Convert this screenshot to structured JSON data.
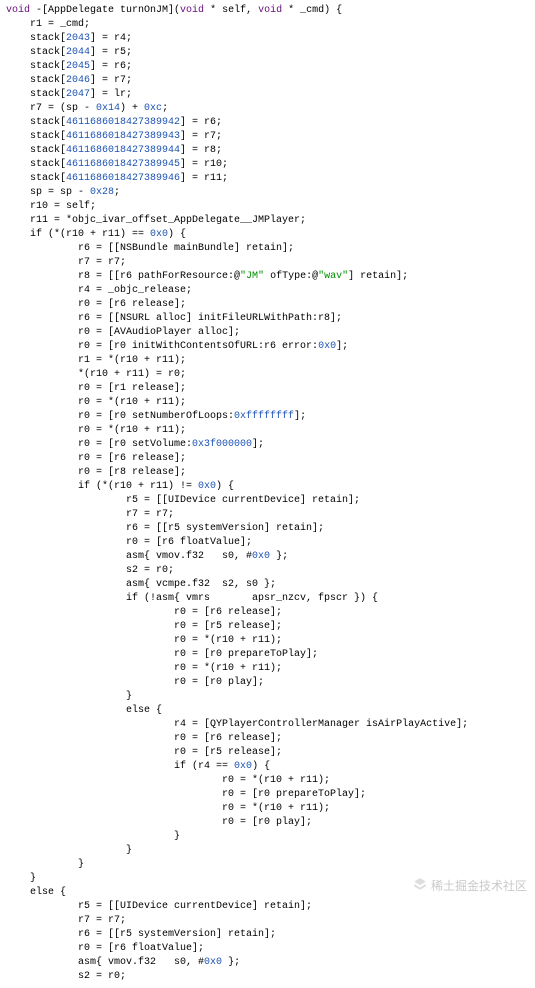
{
  "code": {
    "sig_kw": "void",
    "sig_rest": " -[AppDelegate turnOnJM](",
    "sig_kw2": "void",
    "sig_mid": " * self, ",
    "sig_kw3": "void",
    "sig_end": " * _cmd) {",
    "l01": "    r1 = _cmd;",
    "l02a": "    stack[",
    "l02n": "2043",
    "l02b": "] = r4;",
    "l03a": "    stack[",
    "l03n": "2044",
    "l03b": "] = r5;",
    "l04a": "    stack[",
    "l04n": "2045",
    "l04b": "] = r6;",
    "l05a": "    stack[",
    "l05n": "2046",
    "l05b": "] = r7;",
    "l06a": "    stack[",
    "l06n": "2047",
    "l06b": "] = lr;",
    "l07a": "    r7 = (sp - ",
    "l07n1": "0x14",
    "l07m": ") + ",
    "l07n2": "0xc",
    "l07e": ";",
    "l08a": "    stack[",
    "l08n": "4611686018427389942",
    "l08b": "] = r6;",
    "l09a": "    stack[",
    "l09n": "4611686018427389943",
    "l09b": "] = r7;",
    "l10a": "    stack[",
    "l10n": "4611686018427389944",
    "l10b": "] = r8;",
    "l11a": "    stack[",
    "l11n": "4611686018427389945",
    "l11b": "] = r10;",
    "l12a": "    stack[",
    "l12n": "4611686018427389946",
    "l12b": "] = r11;",
    "l13a": "    sp = sp - ",
    "l13n": "0x28",
    "l13e": ";",
    "l14": "    r10 = self;",
    "l15": "    r11 = *objc_ivar_offset_AppDelegate__JMPlayer;",
    "l16a": "    if (*(r10 + r11) == ",
    "l16n": "0x0",
    "l16b": ") {",
    "l17": "            r6 = [[NSBundle mainBundle] retain];",
    "l18": "            r7 = r7;",
    "l19a": "            r8 = [[r6 pathForResource:@",
    "l19s1": "\"JM\"",
    "l19m": " ofType:@",
    "l19s2": "\"wav\"",
    "l19e": "] retain];",
    "l20": "            r4 = _objc_release;",
    "l21": "            r0 = [r6 release];",
    "l22": "            r6 = [[NSURL alloc] initFileURLWithPath:r8];",
    "l23": "            r0 = [AVAudioPlayer alloc];",
    "l24a": "            r0 = [r0 initWithContentsOfURL:r6 error:",
    "l24n": "0x0",
    "l24e": "];",
    "l25": "            r1 = *(r10 + r11);",
    "l26": "            *(r10 + r11) = r0;",
    "l27": "            r0 = [r1 release];",
    "l28": "            r0 = *(r10 + r11);",
    "l29a": "            r0 = [r0 setNumberOfLoops:",
    "l29n": "0xffffffff",
    "l29e": "];",
    "l30": "            r0 = *(r10 + r11);",
    "l31a": "            r0 = [r0 setVolume:",
    "l31n": "0x3f000000",
    "l31e": "];",
    "l32": "            r0 = [r6 release];",
    "l33": "            r0 = [r8 release];",
    "l34a": "            if (*(r10 + r11) != ",
    "l34n": "0x0",
    "l34b": ") {",
    "l35": "                    r5 = [[UIDevice currentDevice] retain];",
    "l36": "                    r7 = r7;",
    "l37": "                    r6 = [[r5 systemVersion] retain];",
    "l38": "                    r0 = [r6 floatValue];",
    "l39a": "                    asm{ vmov.f32   s0, #",
    "l39n": "0x0",
    "l39e": " };",
    "l40": "                    s2 = r0;",
    "l41": "                    asm{ vcmpe.f32  s2, s0 };",
    "l42": "                    if (!asm{ vmrs       apsr_nzcv, fpscr }) {",
    "l43": "                            r0 = [r6 release];",
    "l44": "                            r0 = [r5 release];",
    "l45": "                            r0 = *(r10 + r11);",
    "l46": "                            r0 = [r0 prepareToPlay];",
    "l47": "                            r0 = *(r10 + r11);",
    "l48": "                            r0 = [r0 play];",
    "l49": "                    }",
    "l50": "                    else {",
    "l51": "                            r4 = [QYPlayerControllerManager isAirPlayActive];",
    "l52": "                            r0 = [r6 release];",
    "l53": "                            r0 = [r5 release];",
    "l54a": "                            if (r4 == ",
    "l54n": "0x0",
    "l54b": ") {",
    "l55": "                                    r0 = *(r10 + r11);",
    "l56": "                                    r0 = [r0 prepareToPlay];",
    "l57": "                                    r0 = *(r10 + r11);",
    "l58": "                                    r0 = [r0 play];",
    "l59": "                            }",
    "l60": "                    }",
    "l61": "            }",
    "l62": "    }",
    "l63": "    else {",
    "l64": "            r5 = [[UIDevice currentDevice] retain];",
    "l65": "            r7 = r7;",
    "l66": "            r6 = [[r5 systemVersion] retain];",
    "l67": "            r0 = [r6 floatValue];",
    "l68a": "            asm{ vmov.f32   s0, #",
    "l68n": "0x0",
    "l68e": " };",
    "l69": "            s2 = r0;"
  },
  "watermark": "稀土掘金技术社区"
}
